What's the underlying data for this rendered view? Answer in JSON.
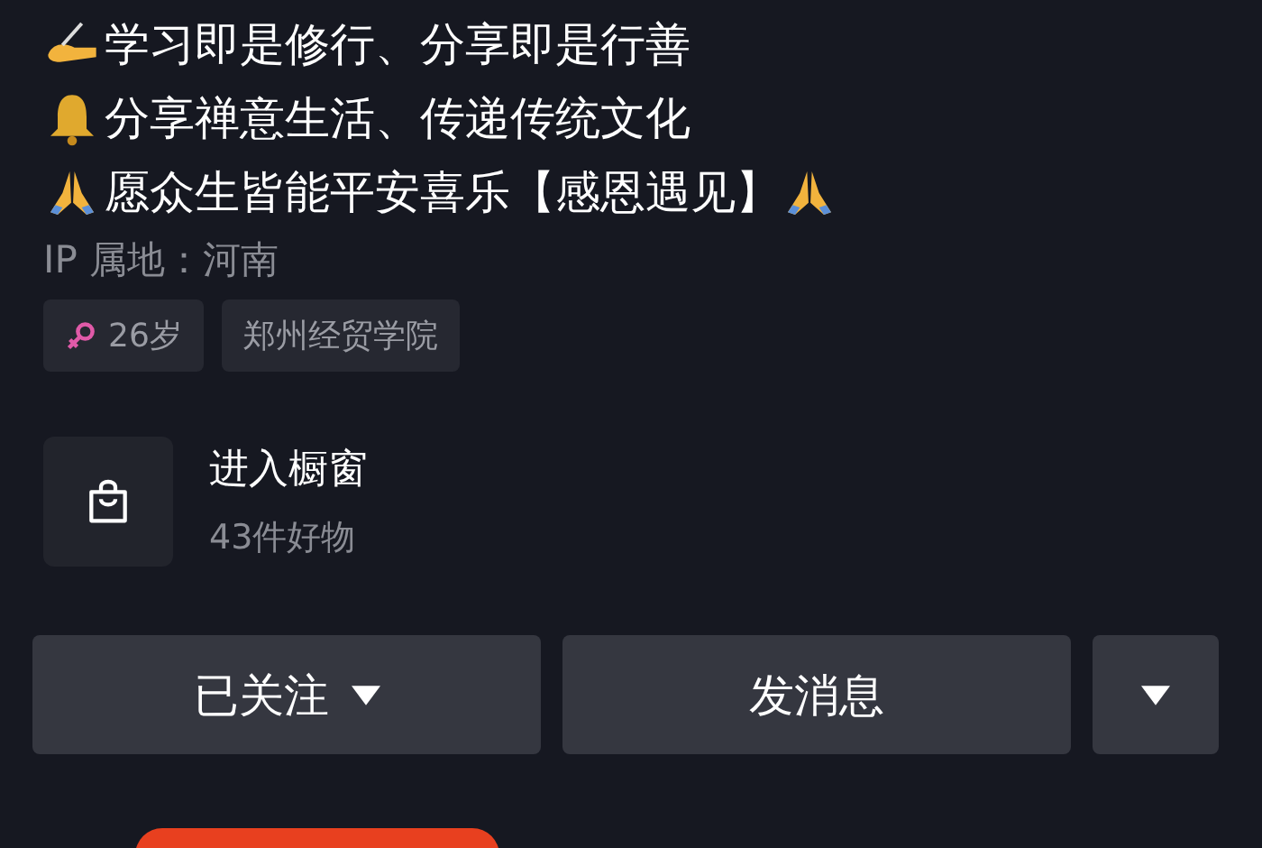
{
  "bio_lines": [
    {
      "kind": "writing",
      "text": "学习即是修行、分享即是行善"
    },
    {
      "kind": "bell",
      "text": "分享禅意生活、传递传统文化"
    },
    {
      "kind": "pray",
      "text": "愿众生皆能平安喜乐【感恩遇见】",
      "trailing_pray": true
    }
  ],
  "ip_location": "IP 属地：河南",
  "tags": [
    {
      "kind": "gender",
      "text": "26岁"
    },
    {
      "kind": "plain",
      "text": "郑州经贸学院"
    }
  ],
  "shop": {
    "title": "进入橱窗",
    "subtitle": "43件好物"
  },
  "buttons": [
    {
      "kind": "follow",
      "label": "已关注"
    },
    {
      "kind": "message",
      "label": "发消息"
    },
    {
      "kind": "more"
    }
  ]
}
